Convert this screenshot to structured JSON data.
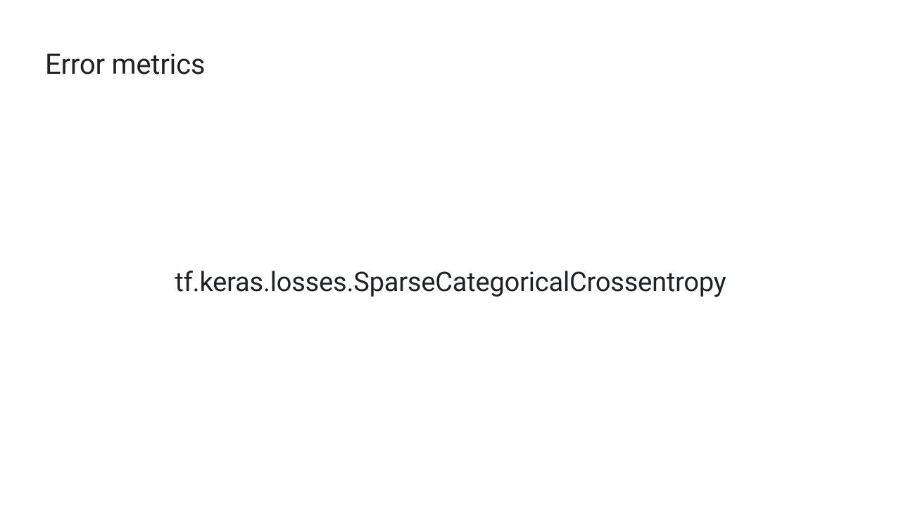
{
  "slide": {
    "title": "Error metrics",
    "body": "tf.keras.losses.SparseCategoricalCrossentropy"
  }
}
